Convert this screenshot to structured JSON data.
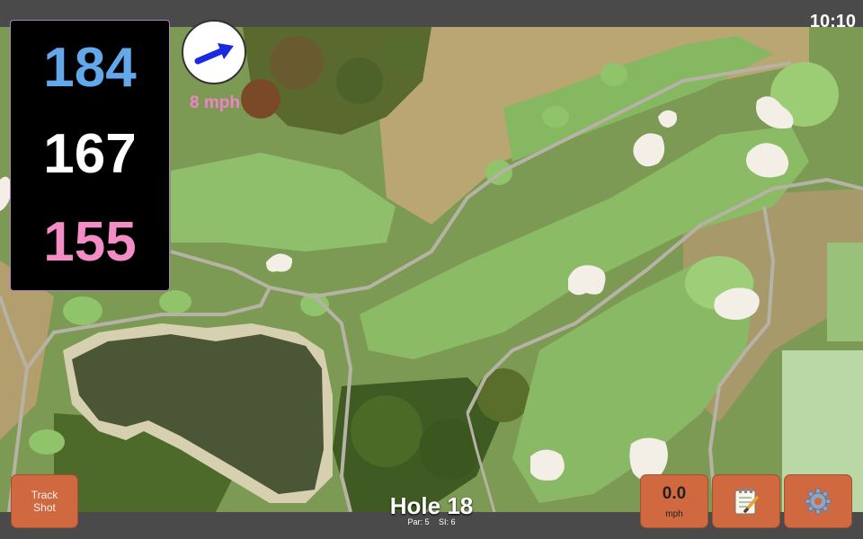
{
  "status": {
    "time": "10:10"
  },
  "distances": {
    "back": "184",
    "middle": "167",
    "front": "155"
  },
  "wind": {
    "speed_label": "8 mph",
    "arrow_icon": "wind-arrow-icon"
  },
  "buttons": {
    "track_shot": "Track Shot",
    "wind_value": "0.0",
    "wind_unit": "mph",
    "notes_icon": "notepad-icon",
    "settings_icon": "gear-icon"
  },
  "hole": {
    "title": "Hole 18",
    "par": "Par: 5",
    "si": "SI: 6"
  },
  "colors": {
    "back": "#64a8ec",
    "middle": "#ffffff",
    "front": "#f48dc6",
    "button": "#d0693f",
    "wind_label": "#f083c8"
  }
}
